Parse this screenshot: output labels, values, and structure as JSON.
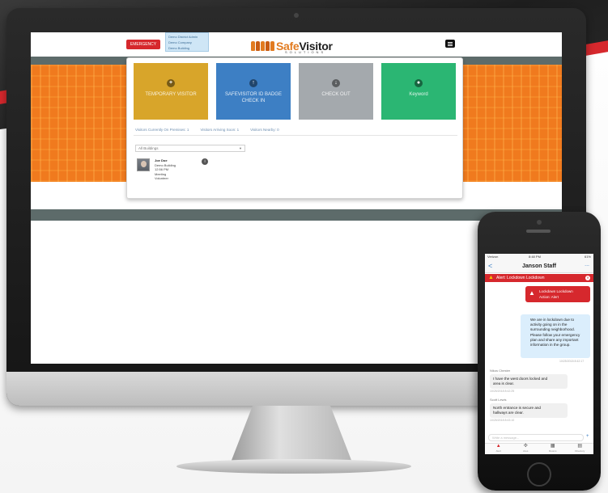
{
  "header": {
    "emergency_label": "EMERGENCY",
    "user_menu": [
      "Demo District Admin",
      "Demo Company",
      "Demo Building"
    ],
    "logo_safe": "Safe",
    "logo_visitor": "Visitor",
    "logo_sub": "SOLUTIONS"
  },
  "tiles": [
    {
      "label": "TEMPORARY VISITOR",
      "icon": "+",
      "color": "#d8a52a"
    },
    {
      "label": "SAFEVISITOR ID BADGE CHECK IN",
      "icon": "↑",
      "color": "#3d7fc4"
    },
    {
      "label": "CHECK OUT",
      "icon": "↓",
      "color": "#a4a9ad"
    },
    {
      "label": "Keyword",
      "icon": "●",
      "color": "#2bb673"
    }
  ],
  "tabs": [
    "Visitors Currently On Premises: 1",
    "Visitors Arriving Soon: 1",
    "Visitors Nearby: 0"
  ],
  "building_select": "All Buildings",
  "visitor": {
    "name": "Joe Doe",
    "building": "Demo Building",
    "time": "12:56 PM",
    "purpose": "Meeting",
    "type": "Volunteer"
  },
  "phone": {
    "carrier": "Verizon",
    "time": "8:48 PM",
    "battery": "61%",
    "back_label": "<",
    "title": "Janson Staff",
    "more_label": "...",
    "alert_text": "Alert: Lockdown Lockdown",
    "alert_bubble": [
      "Lockdown Lockdown",
      "Action: Alert"
    ],
    "message_main": [
      "We are in lockdown due to",
      "activity going on in the",
      "surrounding neighborhood.",
      "Please follow your emergency",
      "plan and share any important",
      "information in the group."
    ],
    "message_main_time": "10/25/2018 8:42:17",
    "sender_1": "Nikos Chester",
    "message_1": [
      "I have the west doors locked and",
      "area is clear."
    ],
    "message_1_time": "10/25/2018 8:42:25",
    "sender_2": "Scott Lewis",
    "message_2": [
      "North entrance is secure and",
      "hallways are clear."
    ],
    "message_2_time": "10/25/2018 8:43:10",
    "input_placeholder": "Write a message...",
    "plus_label": "+",
    "tabbar": [
      {
        "label": "Alert",
        "icon": "▲"
      },
      {
        "label": "Ares",
        "icon": "✣"
      },
      {
        "label": "Rooms",
        "icon": "▦"
      },
      {
        "label": "Directory",
        "icon": "▤"
      }
    ]
  }
}
